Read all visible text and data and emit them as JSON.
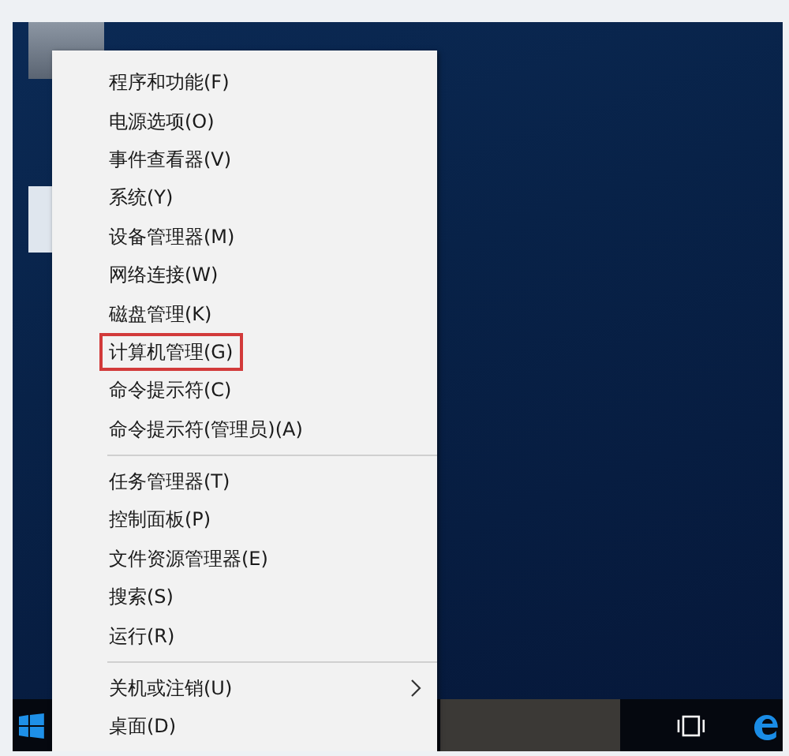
{
  "menu": {
    "groups": [
      {
        "items": [
          {
            "label": "程序和功能(F)",
            "highlighted": false,
            "submenu": false
          },
          {
            "label": "电源选项(O)",
            "highlighted": false,
            "submenu": false
          },
          {
            "label": "事件查看器(V)",
            "highlighted": false,
            "submenu": false
          },
          {
            "label": "系统(Y)",
            "highlighted": false,
            "submenu": false
          },
          {
            "label": "设备管理器(M)",
            "highlighted": false,
            "submenu": false
          },
          {
            "label": "网络连接(W)",
            "highlighted": false,
            "submenu": false
          },
          {
            "label": "磁盘管理(K)",
            "highlighted": false,
            "submenu": false
          },
          {
            "label": "计算机管理(G)",
            "highlighted": true,
            "submenu": false
          },
          {
            "label": "命令提示符(C)",
            "highlighted": false,
            "submenu": false
          },
          {
            "label": "命令提示符(管理员)(A)",
            "highlighted": false,
            "submenu": false
          }
        ]
      },
      {
        "items": [
          {
            "label": "任务管理器(T)",
            "highlighted": false,
            "submenu": false
          },
          {
            "label": "控制面板(P)",
            "highlighted": false,
            "submenu": false
          },
          {
            "label": "文件资源管理器(E)",
            "highlighted": false,
            "submenu": false
          },
          {
            "label": "搜索(S)",
            "highlighted": false,
            "submenu": false
          },
          {
            "label": "运行(R)",
            "highlighted": false,
            "submenu": false
          }
        ]
      },
      {
        "items": [
          {
            "label": "关机或注销(U)",
            "highlighted": false,
            "submenu": true
          },
          {
            "label": "桌面(D)",
            "highlighted": false,
            "submenu": false
          }
        ]
      }
    ]
  }
}
